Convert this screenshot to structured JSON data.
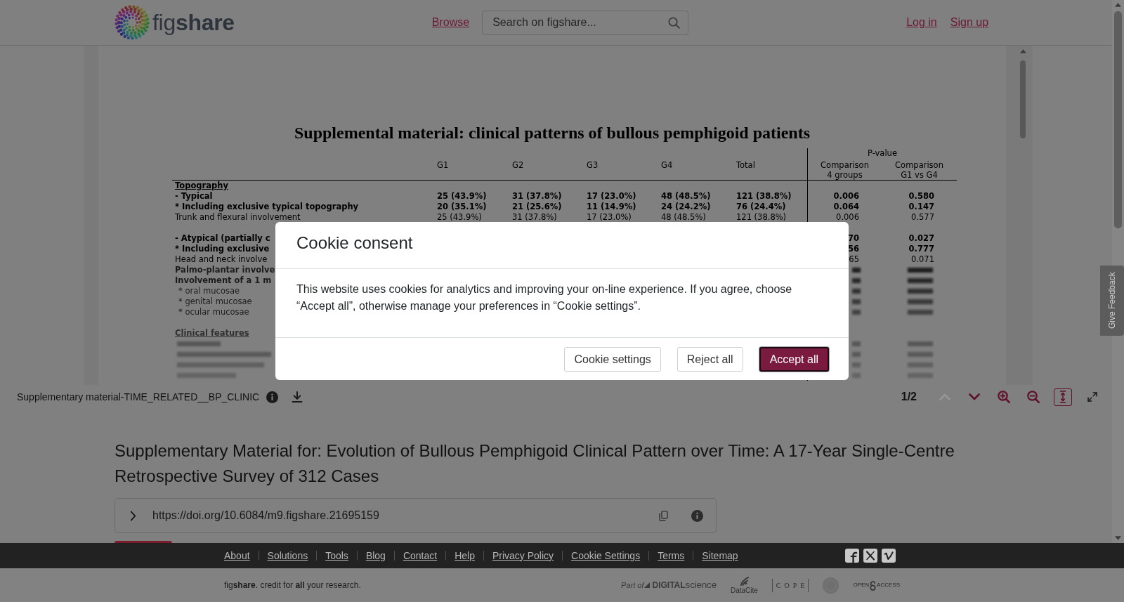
{
  "header": {
    "logo": "fig**share**",
    "nav_link": "Browse",
    "search": {
      "placeholder": "Search on figshare..."
    },
    "account_links": [
      "Log in",
      "Sign up"
    ]
  },
  "viewer": {
    "document": {
      "title": "Supplemental material: clinical patterns of bullous pemphigoid patients",
      "table": {
        "columns": [
          "G1",
          "G2",
          "G3",
          "G4",
          "Total"
        ],
        "column_group": {
          "label": "P-value",
          "columns": [
            {
              "label": "Comparison",
              "sublabel": "4 groups"
            },
            {
              "label": "Comparison",
              "sublabel": "G1 vs G4"
            }
          ]
        },
        "rows": [
          {
            "kind": "section",
            "label": "Topography"
          },
          {
            "kind": "bold",
            "label": "- Typical",
            "cells": [
              "25 (43.9%)",
              "31 (37.8%)",
              "17 (23.0%)",
              "48 (48.5%)",
              "121 (38.8%)",
              "0.006",
              "0.580"
            ]
          },
          {
            "kind": "bold",
            "label": "* Including exclusive typical topography",
            "cells": [
              "20 (35.1%)",
              "21 (25.6%)",
              "11 (14.9%)",
              "24 (24.2%)",
              "76 (24.4%)",
              "0.064",
              "0.147"
            ]
          },
          {
            "kind": "plain",
            "label": "Trunk and flexural involvement",
            "cells": [
              "25 (43.9%)",
              "31 (37.8%)",
              "17 (23.0%)",
              "48 (48.5%)",
              "121 (38.8%)",
              "0.006",
              "0.577"
            ]
          },
          {
            "kind": "spacer"
          },
          {
            "kind": "bold",
            "label": "- Atypical (partially c",
            "cells": [
              null,
              null,
              null,
              null,
              null,
              "70",
              "0.027"
            ]
          },
          {
            "kind": "bold",
            "label": "* Including exclusive",
            "cells": [
              null,
              null,
              null,
              null,
              null,
              "56",
              "0.777"
            ]
          },
          {
            "kind": "plain",
            "label": "Head and neck involve",
            "cells": [
              null,
              null,
              null,
              null,
              null,
              "65",
              "0.071"
            ]
          }
        ],
        "blurred_rows": [
          {
            "kind": "bold",
            "label": "Palmo-plantar involve"
          },
          {
            "kind": "bold",
            "label": "Involvement of a 1 m"
          },
          {
            "kind": "sub",
            "label": "* oral mucosae"
          },
          {
            "kind": "sub",
            "label": "* genital mucosae"
          },
          {
            "kind": "sub",
            "label": "* ocular mucosae"
          },
          {
            "kind": "spacer"
          },
          {
            "kind": "section",
            "label": "Clinical features"
          }
        ]
      }
    },
    "toolbar": {
      "file_name": "Supplementary material-TIME_RELATED__BP_CLINIC",
      "page_indicator": "1/2",
      "controls": [
        {
          "kind": "previous-page",
          "disabled": true,
          "active": false
        },
        {
          "kind": "next-page",
          "disabled": false,
          "active": false
        },
        {
          "kind": "zoom-in",
          "disabled": false,
          "active": false
        },
        {
          "kind": "zoom-out",
          "disabled": false,
          "active": false
        },
        {
          "kind": "fit-height",
          "disabled": false,
          "active": true
        },
        {
          "kind": "fullscreen",
          "disabled": false,
          "active": false
        }
      ]
    }
  },
  "item": {
    "title": "Supplementary Material for: Evolution of Bullous Pemphigoid Clinical Pattern over Time: A 17-Year Single-Centre Retrospective Survey of 312 Cases",
    "doi": "https://doi.org/10.6084/m9.figshare.21695159"
  },
  "footer": {
    "links": [
      "About",
      "Solutions",
      "Tools",
      "Blog",
      "Contact",
      "Help",
      "Privacy Policy",
      "Cookie Settings",
      "Terms",
      "Sitemap"
    ],
    "tagline": "fig**share**. credit for **all** your research.",
    "partners": [
      {
        "kind": "digital-science",
        "prefix": "Part of",
        "name": "**DIGITAL**science"
      },
      {
        "kind": "datacite",
        "name": "DataCite"
      },
      {
        "kind": "cope",
        "name": "COPE"
      },
      {
        "kind": "seal"
      },
      {
        "kind": "open-access",
        "words": [
          "OPEN",
          "ACCESS"
        ]
      }
    ]
  },
  "feedback_tab": {
    "label": "Give Feedback"
  },
  "cookie_dialog": {
    "title": "Cookie consent",
    "message": "This website uses cookies for analytics and improving your on-line experience. If you agree, choose “Accept all”, otherwise manage your preferences in “Cookie settings”.",
    "buttons": [
      {
        "label": "Cookie settings",
        "kind": "secondary",
        "focused": false
      },
      {
        "label": "Reject all",
        "kind": "secondary",
        "focused": false
      },
      {
        "label": "Accept all",
        "kind": "primary",
        "focused": true
      }
    ]
  }
}
